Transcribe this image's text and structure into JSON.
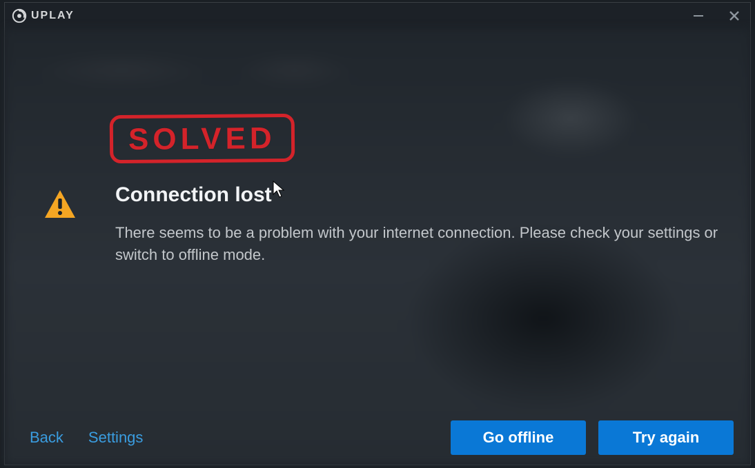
{
  "titlebar": {
    "brand": "UPLAY"
  },
  "stamp": {
    "label": "SOLVED"
  },
  "error": {
    "heading": "Connection lost",
    "body": "There seems to be a problem with your internet connection. Please check your settings or switch to offline mode."
  },
  "footer": {
    "back": "Back",
    "settings": "Settings",
    "go_offline": "Go offline",
    "try_again": "Try again"
  },
  "colors": {
    "accent": "#0a78d6",
    "link": "#3a9de0",
    "stamp": "#d4232a",
    "warning": "#f5a623"
  }
}
